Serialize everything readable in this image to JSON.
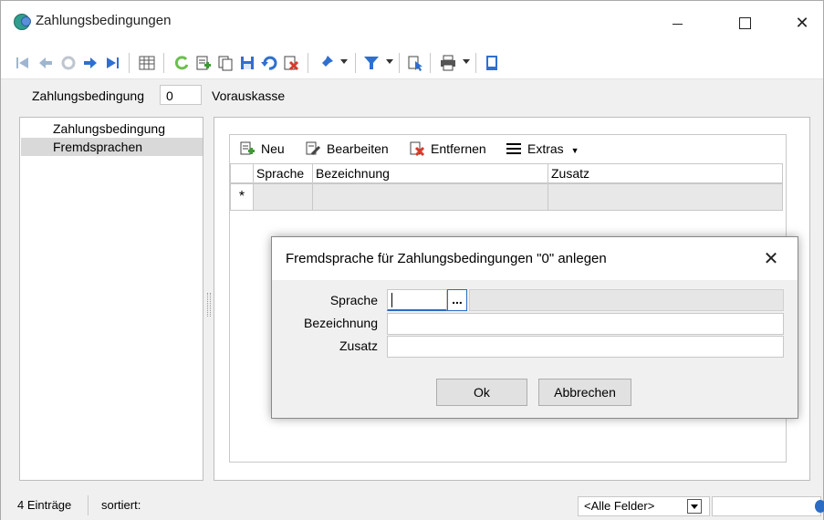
{
  "window": {
    "title": "Zahlungsbedingungen"
  },
  "header": {
    "label": "Zahlungsbedingung",
    "value": "0",
    "description": "Vorauskasse"
  },
  "nav": {
    "items": [
      {
        "label": "Zahlungsbedingung"
      },
      {
        "label": "Fremdsprachen",
        "selected": true
      }
    ]
  },
  "grid_toolbar": {
    "new_label": "Neu",
    "edit_label": "Bearbeiten",
    "remove_label": "Entfernen",
    "extras_label": "Extras"
  },
  "grid": {
    "columns": [
      "Sprache",
      "Bezeichnung",
      "Zusatz"
    ],
    "new_row_marker": "*"
  },
  "dialog": {
    "title": "Fremdsprache für Zahlungsbedingungen \"0\" anlegen",
    "fields": {
      "sprache_label": "Sprache",
      "bezeichnung_label": "Bezeichnung",
      "zusatz_label": "Zusatz"
    },
    "browse_label": "...",
    "ok_label": "Ok",
    "cancel_label": "Abbrechen"
  },
  "status": {
    "count": "4 Einträge",
    "sort": "sortiert:",
    "filter_field": "<Alle Felder>"
  },
  "toolbar_icons": [
    "first-record-icon",
    "previous-record-icon",
    "refresh-icon",
    "next-record-icon",
    "last-record-icon",
    "table-view-icon",
    "reload-icon",
    "new-record-icon",
    "copy-record-icon",
    "save-icon",
    "undo-icon",
    "delete-icon",
    "pin-icon",
    "filter-icon",
    "cursor-icon",
    "print-icon",
    "book-icon"
  ]
}
